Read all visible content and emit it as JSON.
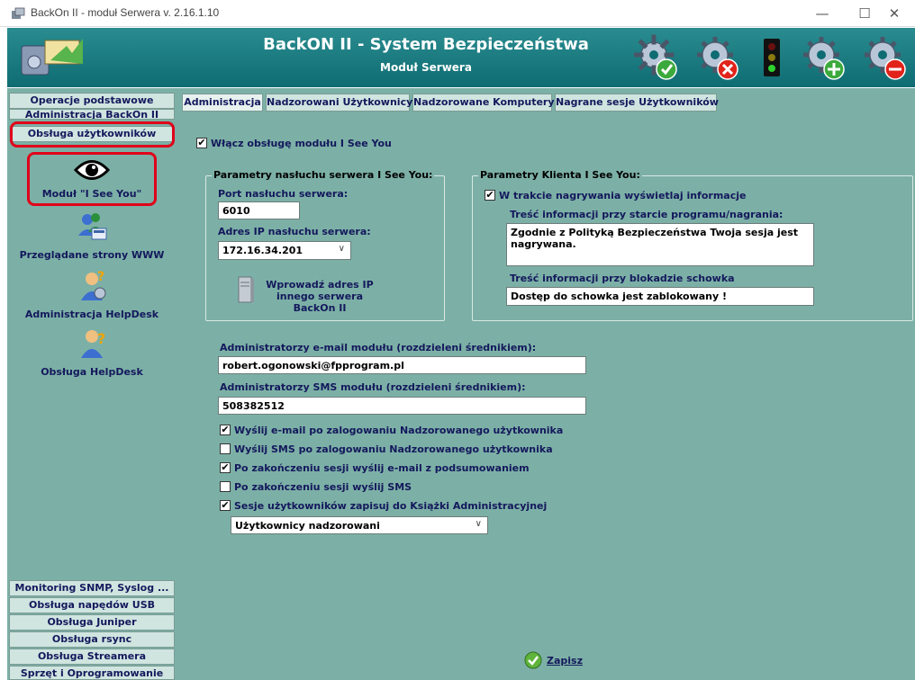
{
  "window": {
    "title": "BackOn II - moduł Serwera v. 2.16.1.10",
    "controls": {
      "minimize": "—",
      "maximize": "☐",
      "close": "✕"
    }
  },
  "header": {
    "title": "BackON II - System Bezpieczeństwa",
    "subtitle": "Moduł Serwera",
    "icons": [
      "gear-check-icon",
      "gear-cancel-icon",
      "traffic-light-icon",
      "gear-add-icon",
      "gear-remove-icon"
    ]
  },
  "sidebar": {
    "top_buttons": [
      "Operacje podstawowe",
      "Administracja BackOn II",
      "Obsługa użytkowników"
    ],
    "items": [
      {
        "label": "Moduł \"I See You\"",
        "icon": "eye-icon"
      },
      {
        "label": "Przeglądane strony WWW",
        "icon": "web-users-icon"
      },
      {
        "label": "Administracja HelpDesk",
        "icon": "helpdesk-admin-icon"
      },
      {
        "label": "Obsługa HelpDesk",
        "icon": "helpdesk-user-icon"
      }
    ],
    "bottom_buttons": [
      "Monitoring SNMP, Syslog ...",
      "Obsługa napędów USB",
      "Obsługa Juniper",
      "Obsługa rsync",
      "Obsługa Streamera",
      "Sprzęt i Oprogramowanie"
    ],
    "highlight_color": "#e0001a"
  },
  "tabs": [
    "Administracja",
    "Nadzorowani Użytkownicy",
    "Nadzorowane Komputery",
    "Nagrane sesje Użytkowników"
  ],
  "form": {
    "enable_module": {
      "label": "Włącz obsługę modułu I See You",
      "checked": true
    },
    "server": {
      "legend": "Parametry nasłuchu serwera I See You:",
      "port_label": "Port nasłuchu serwera:",
      "port_value": "6010",
      "ip_label": "Adres IP nasłuchu serwera:",
      "ip_value": "172.16.34.201",
      "other_ip_button": "Wprowadź adres IP innego serwera BackOn II"
    },
    "client": {
      "legend": "Parametry Klienta I See You:",
      "show_info": {
        "label": "W trakcie nagrywania wyświetlaj informacje",
        "checked": true
      },
      "start_info_label": "Treść informacji przy starcie programu/nagrania:",
      "start_info_value": "Zgodnie z Polityką Bezpieczeństwa Twoja sesja jest nagrywana.",
      "clipboard_label": "Treść informacji przy blokadzie schowka",
      "clipboard_value": "Dostęp do schowka jest zablokowany !"
    },
    "email_admins_label": "Administratorzy e-mail modułu (rozdzieleni średnikiem):",
    "email_admins_value": "robert.ogonowski@fpprogram.pl",
    "sms_admins_label": "Administratorzy SMS modułu (rozdzieleni średnikiem):",
    "sms_admins_value": "508382512",
    "options": [
      {
        "label": "Wyślij e-mail po zalogowaniu Nadzorowanego użytkownika",
        "checked": true
      },
      {
        "label": "Wyślij SMS po zalogowaniu Nadzorowanego użytkownika",
        "checked": false
      },
      {
        "label": "Po zakończeniu sesji wyślij e-mail z podsumowaniem",
        "checked": true
      },
      {
        "label": "Po zakończeniu sesji wyślij SMS",
        "checked": false
      },
      {
        "label": "Sesje użytkowników zapisuj do Książki Administracyjnej",
        "checked": true
      }
    ],
    "users_select_value": "Użytkownicy nadzorowani",
    "save_button": "Zapisz"
  },
  "check_mark": "✔"
}
